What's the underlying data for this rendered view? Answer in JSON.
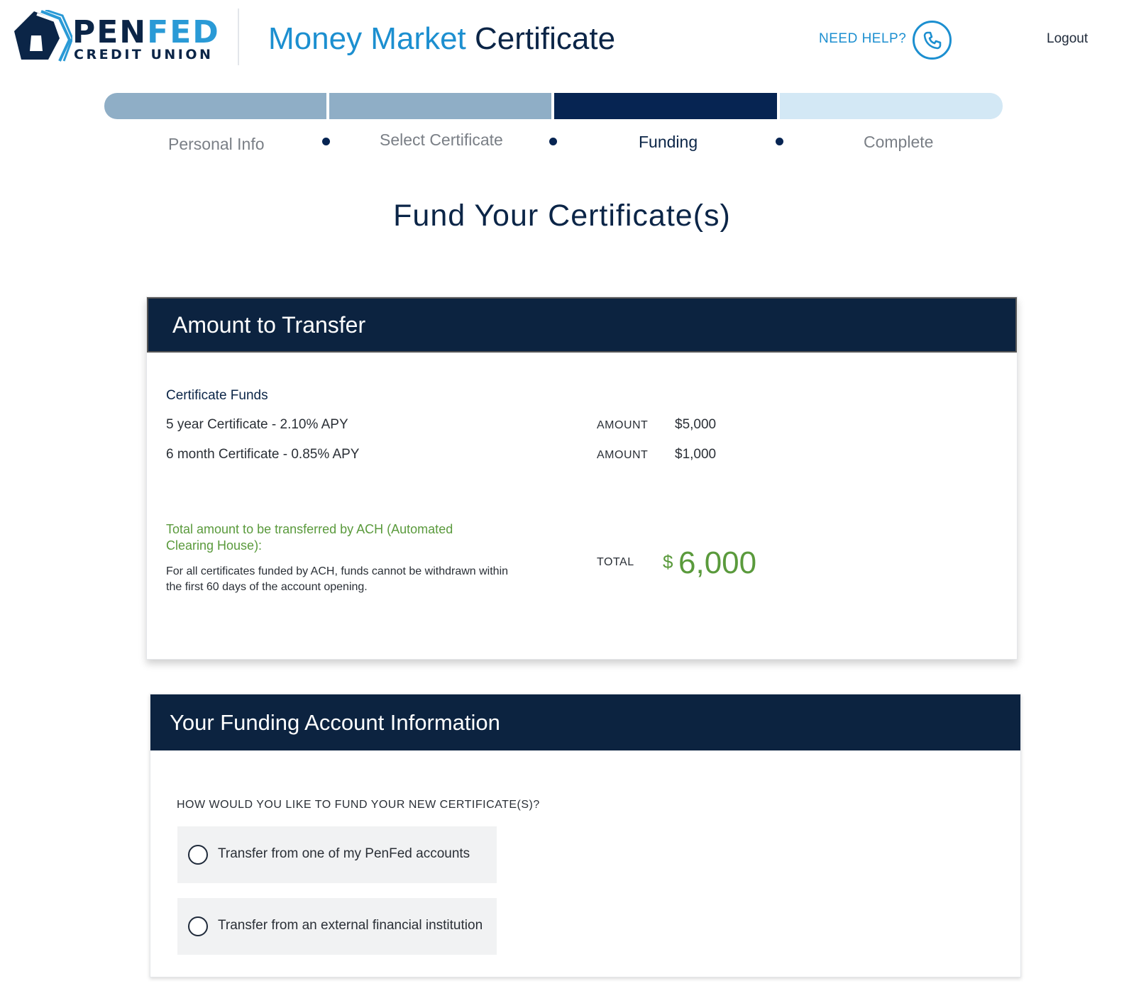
{
  "brand": {
    "logo_name": "PENFED",
    "logo_pen": "PEN",
    "logo_fed": "FED",
    "logo_sub": "CREDIT UNION"
  },
  "header": {
    "title_part1": "Money Market",
    "title_part2": "Certificate",
    "need_help": "NEED HELP?",
    "logout": "Logout"
  },
  "steps": [
    {
      "label": "Personal Info",
      "state": "done"
    },
    {
      "label": "Select Certificate",
      "state": "done"
    },
    {
      "label": "Funding",
      "state": "current"
    },
    {
      "label": "Complete",
      "state": "upcoming"
    }
  ],
  "page_title": "Fund Your Certificate(s)",
  "transfer": {
    "heading": "Amount to Transfer",
    "section_title": "Certificate Funds",
    "rows": [
      {
        "name": "5 year Certificate - 2.10% APY",
        "amount_label": "AMOUNT",
        "amount": "$5,000"
      },
      {
        "name": "6 month Certificate - 0.85% APY",
        "amount_label": "AMOUNT",
        "amount": "$1,000"
      }
    ],
    "total_title": "Total amount to be transferred by ACH (Automated Clearing House):",
    "total_note": "For all certificates funded by ACH, funds cannot be withdrawn within the first 60 days of the account opening.",
    "total_label": "TOTAL",
    "total_currency": "$",
    "total_value": "6,000"
  },
  "funding": {
    "heading": "Your Funding Account Information",
    "question": "HOW WOULD YOU LIKE TO FUND YOUR NEW CERTIFICATE(S)?",
    "options": [
      {
        "label": "Transfer from one of my PenFed accounts",
        "selected": false
      },
      {
        "label": "Transfer from an external financial institution",
        "selected": false
      }
    ]
  },
  "colors": {
    "navy": "#0c2340",
    "accent_blue": "#1c8fd0",
    "progress_done": "#8faec6",
    "progress_current": "#062452",
    "progress_upcoming": "#d3e8f5",
    "total_green": "#5a9a3c"
  },
  "icons": {
    "logo": "penfed-pentagon-logo",
    "help": "phone-icon",
    "radio": "radio-unchecked-icon"
  }
}
